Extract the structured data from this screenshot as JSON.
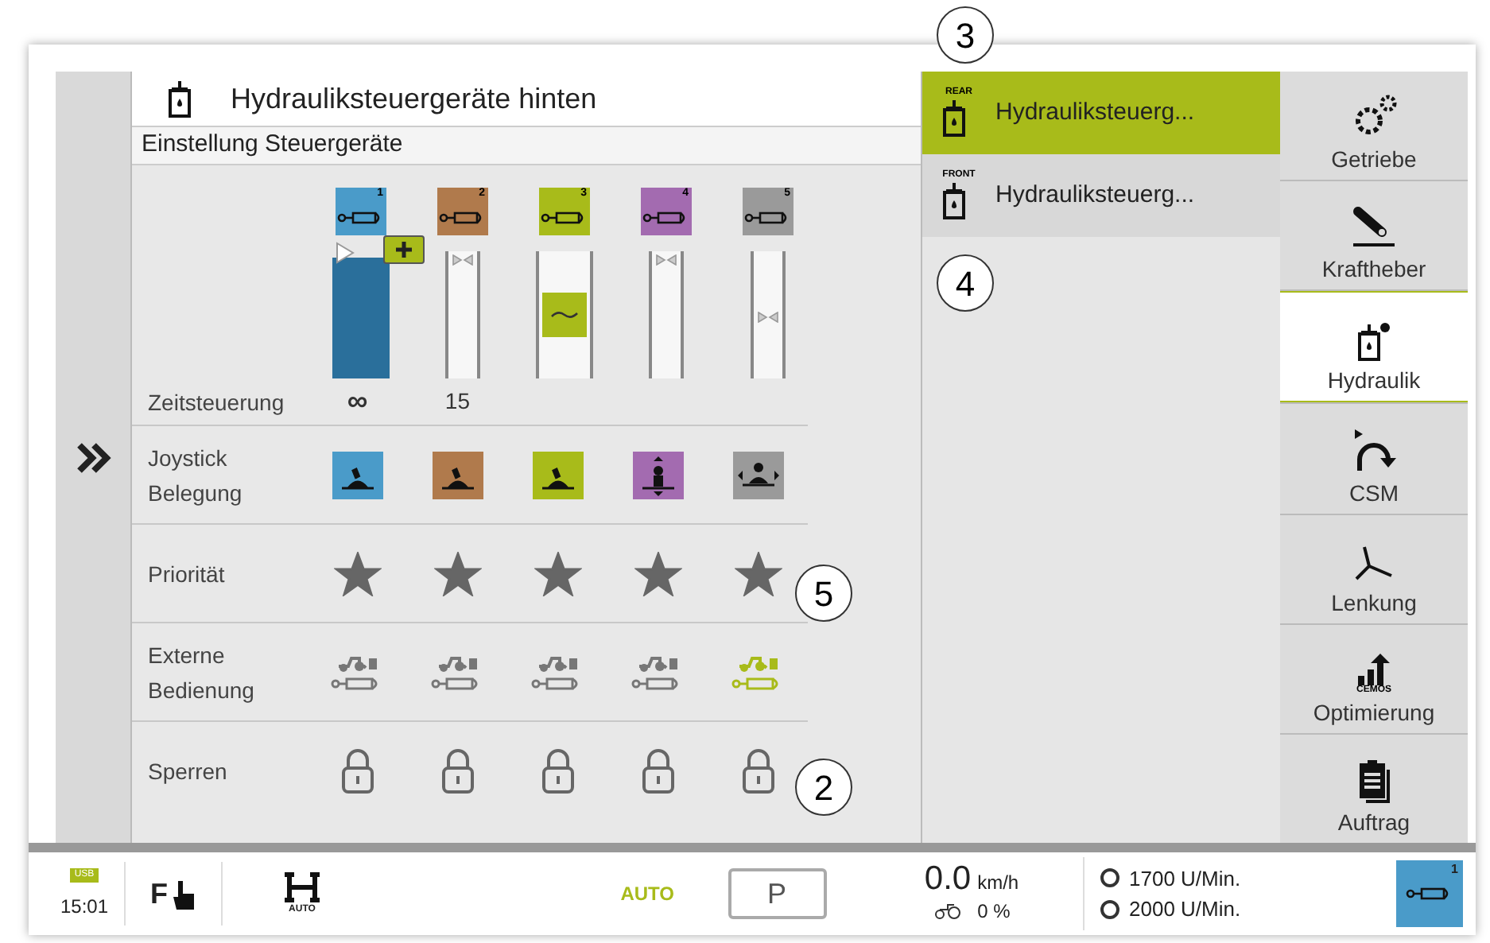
{
  "header": {
    "title": "Hydrauliksteuergeräte hinten",
    "subtitle": "Einstellung Steuergeräte"
  },
  "valves": [
    {
      "number": "1",
      "color": "#4a9bc9",
      "kind": "flow",
      "time": "∞"
    },
    {
      "number": "2",
      "color": "#b07a4c",
      "kind": "marks",
      "time": "15"
    },
    {
      "number": "3",
      "color": "#a8bb1a",
      "kind": "float"
    },
    {
      "number": "4",
      "color": "#a36bb0",
      "kind": "marks"
    },
    {
      "number": "5",
      "color": "#9a9a9a",
      "kind": "narrow"
    }
  ],
  "row_labels": {
    "time": "Zeitsteuerung",
    "joystick": "Joystick Belegung",
    "priority": "Priorität",
    "external": "Externe Bedienung",
    "locks": "Sperren"
  },
  "joystick": [
    {
      "kind": "push"
    },
    {
      "kind": "push"
    },
    {
      "kind": "push"
    },
    {
      "kind": "updown"
    },
    {
      "kind": "leftright"
    }
  ],
  "priority": [
    {
      "on": true
    },
    {
      "on": true
    },
    {
      "on": true
    },
    {
      "on": true
    },
    {
      "on": true
    }
  ],
  "external": [
    {
      "active": false
    },
    {
      "active": false
    },
    {
      "active": false
    },
    {
      "active": false
    },
    {
      "active": true
    }
  ],
  "locks": [
    {
      "locked": true
    },
    {
      "locked": true
    },
    {
      "locked": true
    },
    {
      "locked": true
    },
    {
      "locked": true
    }
  ],
  "valve_groups": [
    {
      "tag": "REAR",
      "label": "Hydrauliksteuerg...",
      "selected": true
    },
    {
      "tag": "FRONT",
      "label": "Hydrauliksteuerg...",
      "selected": false
    }
  ],
  "nav": [
    {
      "kind": "gears",
      "label": "Getriebe",
      "selected": false
    },
    {
      "kind": "lift",
      "label": "Kraftheber",
      "selected": false
    },
    {
      "kind": "hydraulic",
      "label": "Hydraulik",
      "selected": true
    },
    {
      "kind": "csm",
      "label": "CSM",
      "selected": false
    },
    {
      "kind": "steer",
      "label": "Lenkung",
      "selected": false
    },
    {
      "kind": "cemos",
      "label": "Optimierung",
      "tag": "CEMOS",
      "selected": false
    },
    {
      "kind": "clipboard",
      "label": "Auftrag",
      "selected": false
    }
  ],
  "status_bar": {
    "usb": "USB",
    "time": "15:01",
    "f": "F",
    "axle": "AUTO",
    "auto": "AUTO",
    "park": "P",
    "speed": "0.0",
    "speed_unit": "km/h",
    "slip": "0 %",
    "rpm1": "1700 U/Min.",
    "rpm2": "2000 U/Min.",
    "valve": "1"
  },
  "callouts": [
    {
      "kind": "top",
      "text": "3"
    },
    {
      "kind": "front",
      "text": "4"
    },
    {
      "kind": "priority",
      "text": "5"
    },
    {
      "kind": "locks",
      "text": "2"
    }
  ]
}
